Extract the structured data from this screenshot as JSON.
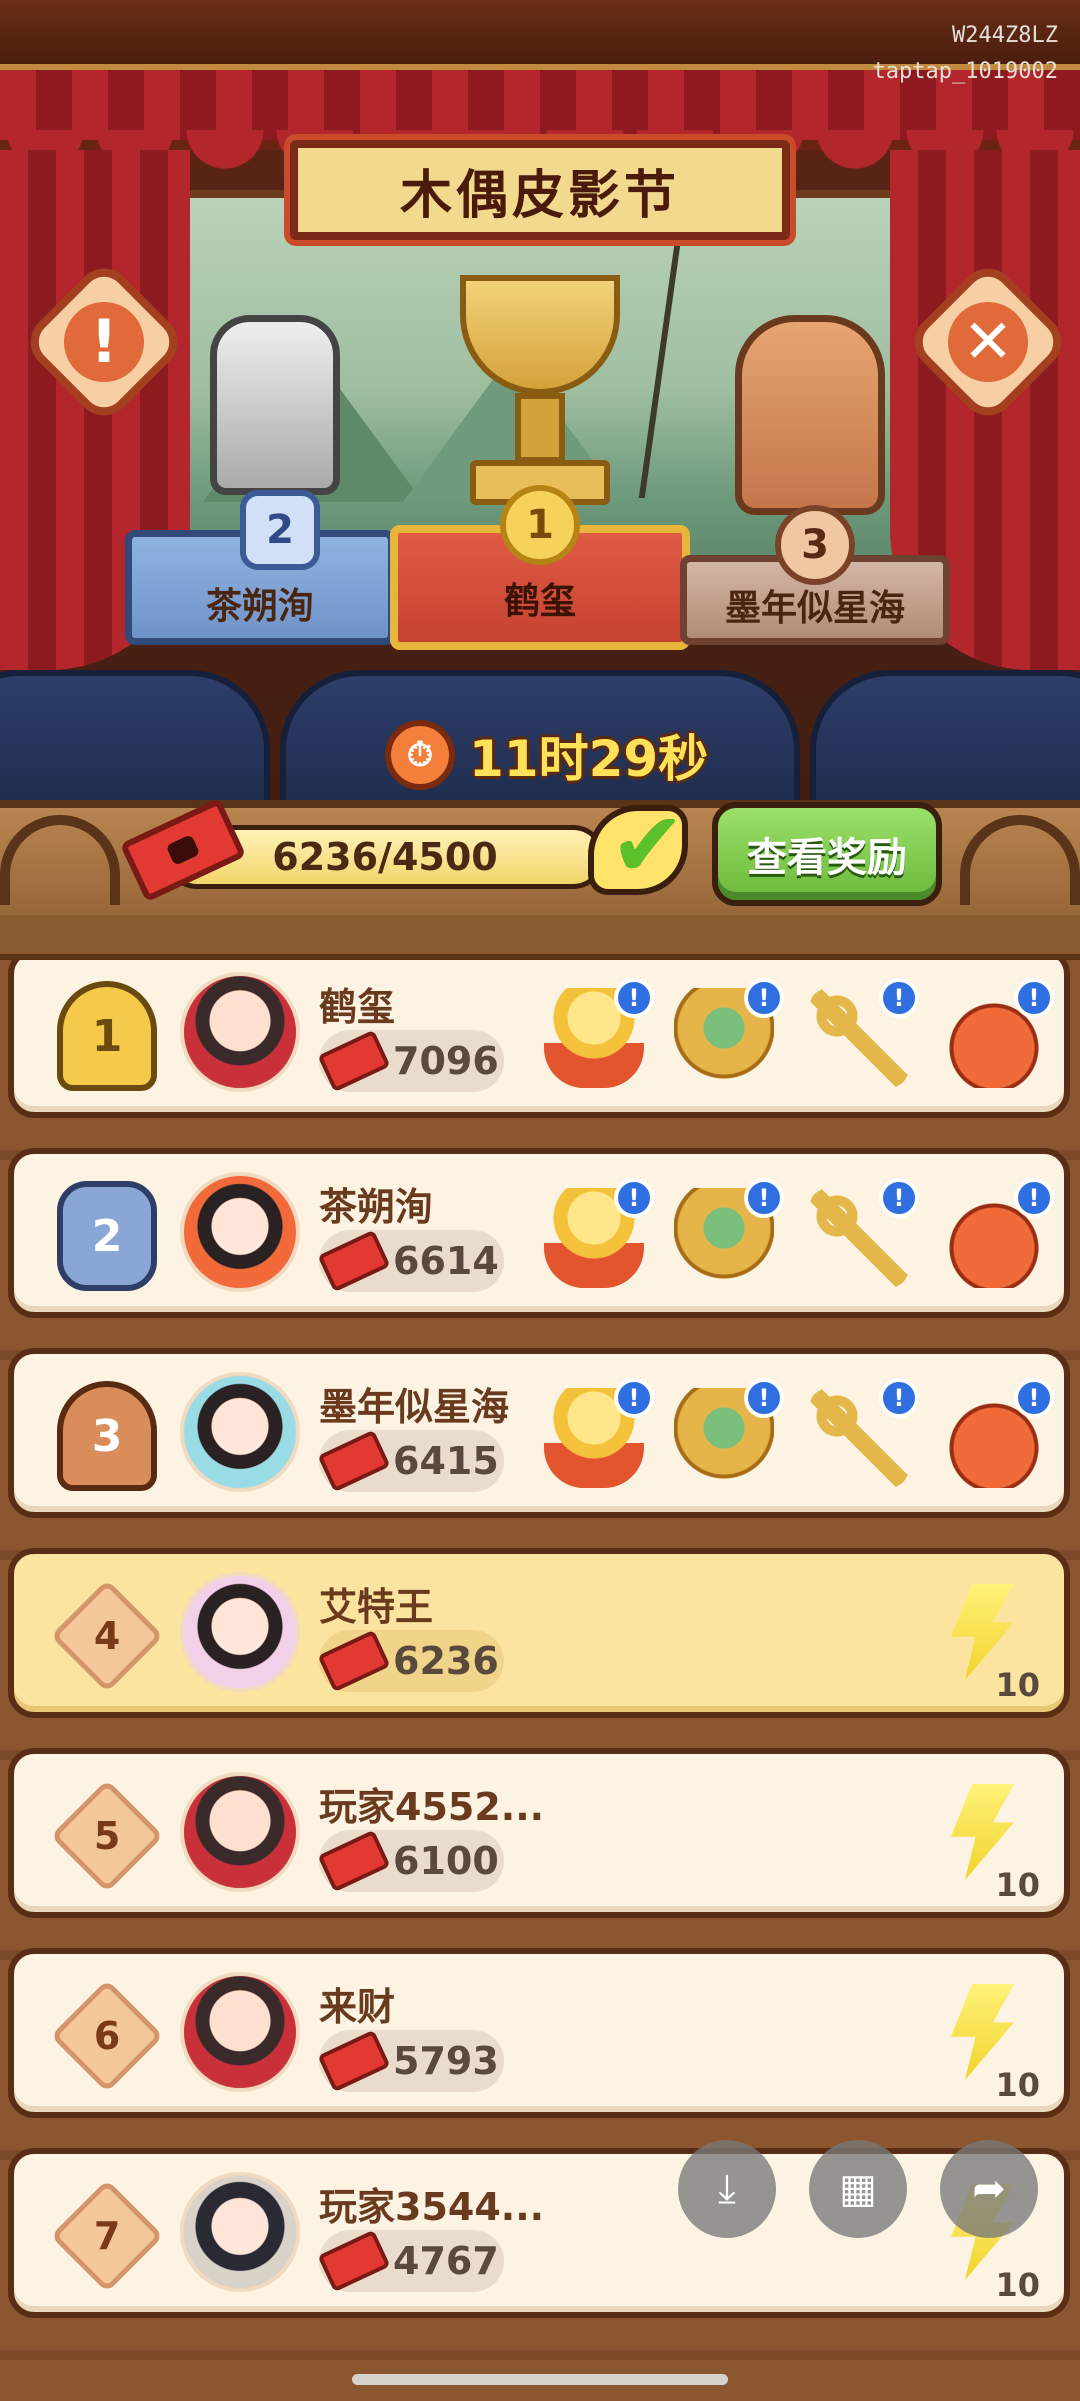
{
  "status_bar": {
    "line1": "W244Z8LZ",
    "line2": "taptap_1019002"
  },
  "event": {
    "title": "木偶皮影节",
    "countdown": "11时29秒",
    "progress_text": "6236/4500",
    "progress_fraction": 1.0,
    "view_rewards_label": "查看奖励"
  },
  "buttons": {
    "info_glyph": "!",
    "close_glyph": "✕"
  },
  "podium": [
    {
      "rank": "2",
      "name": "茶朔洵"
    },
    {
      "rank": "1",
      "name": "鹤玺"
    },
    {
      "rank": "3",
      "name": "墨年似星海"
    }
  ],
  "leaderboard": [
    {
      "rank": "1",
      "name": "鹤玺",
      "score": "7096",
      "rewards": [
        "gold-nuggets",
        "treasure-pot",
        "key",
        "lucky-bag"
      ]
    },
    {
      "rank": "2",
      "name": "茶朔洵",
      "score": "6614",
      "rewards": [
        "gold-nuggets",
        "treasure-pot",
        "key",
        "lucky-bag"
      ]
    },
    {
      "rank": "3",
      "name": "墨年似星海",
      "score": "6415",
      "rewards": [
        "gold-nuggets",
        "treasure-pot",
        "key",
        "lucky-bag"
      ]
    },
    {
      "rank": "4",
      "name": "艾特王",
      "score": "6236",
      "reward_count": "10",
      "is_me": true
    },
    {
      "rank": "5",
      "name": "玩家4552...",
      "score": "6100",
      "reward_count": "10"
    },
    {
      "rank": "6",
      "name": "来财",
      "score": "5793",
      "reward_count": "10"
    },
    {
      "rank": "7",
      "name": "玩家3544...",
      "score": "4767",
      "reward_count": "10"
    }
  ],
  "reward_info_glyph": "!",
  "floating_actions": [
    {
      "icon": "download-icon",
      "glyph": "⤓"
    },
    {
      "icon": "grid-icon",
      "glyph": "▦"
    },
    {
      "icon": "share-icon",
      "glyph": "➦"
    }
  ],
  "colors": {
    "accent_gold": "#f3d98e",
    "curtain_red": "#b3262b",
    "reward_green": "#6ab83a"
  }
}
